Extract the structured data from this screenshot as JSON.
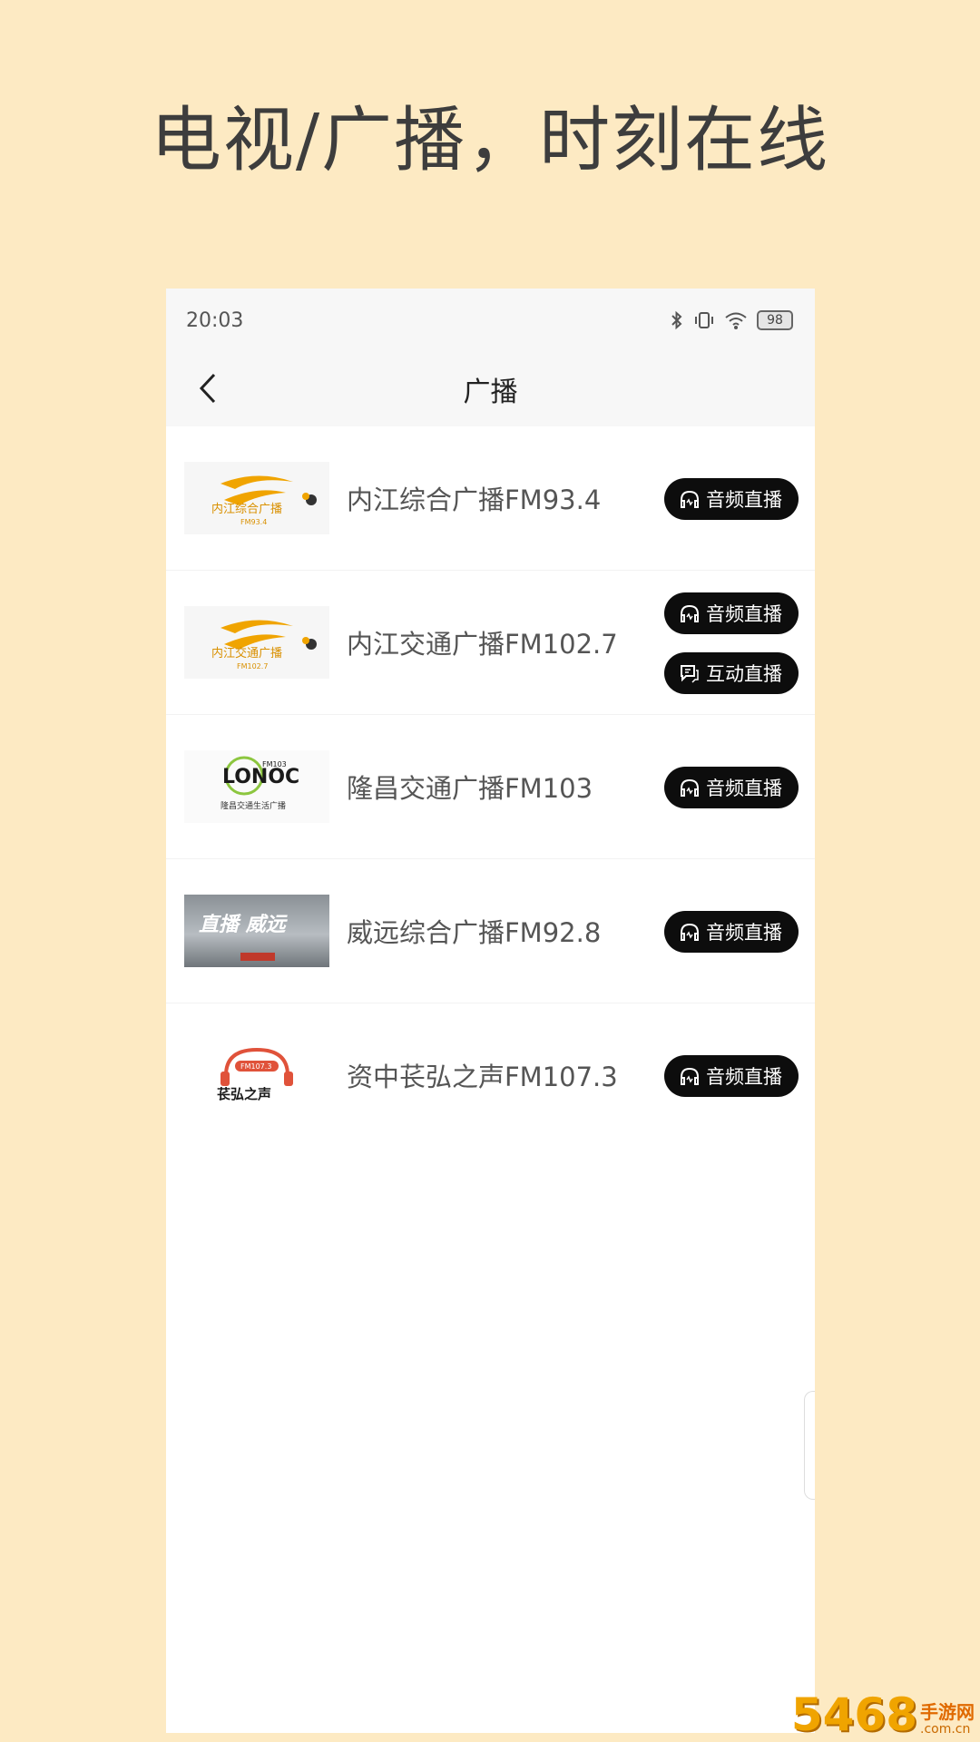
{
  "headline": "电视/广播，时刻在线",
  "status": {
    "time": "20:03",
    "battery": "98"
  },
  "nav": {
    "title": "广播"
  },
  "stations": [
    {
      "name": "内江综合广播FM93.4",
      "logo_text": "内江综合广播",
      "logo_sub": "FM93.4",
      "buttons": [
        {
          "label": "音频直播",
          "icon": "headphones-icon"
        }
      ]
    },
    {
      "name": "内江交通广播FM102.7",
      "logo_text": "内江交通广播",
      "logo_sub": "FM102.7",
      "buttons": [
        {
          "label": "音频直播",
          "icon": "headphones-icon"
        },
        {
          "label": "互动直播",
          "icon": "chat-icon"
        }
      ]
    },
    {
      "name": "隆昌交通广播FM103",
      "logo_text": "LONOC",
      "logo_sub": "隆昌交通生活广播",
      "logo_tag": "FM103",
      "buttons": [
        {
          "label": "音频直播",
          "icon": "headphones-icon"
        }
      ]
    },
    {
      "name": "威远综合广播FM92.8",
      "logo_text": "直播 威远",
      "buttons": [
        {
          "label": "音频直播",
          "icon": "headphones-icon"
        }
      ]
    },
    {
      "name": "资中苌弘之声FM107.3",
      "logo_text": "苌弘之声",
      "logo_tag": "FM107.3",
      "buttons": [
        {
          "label": "音频直播",
          "icon": "headphones-icon"
        }
      ]
    }
  ],
  "watermark": {
    "num": "5468",
    "name": "手游网",
    "domain": ".com.cn"
  },
  "colors": {
    "page_bg": "#fdeac3",
    "button_bg": "#0d0d0d",
    "logo_orange": "#f0a400"
  }
}
